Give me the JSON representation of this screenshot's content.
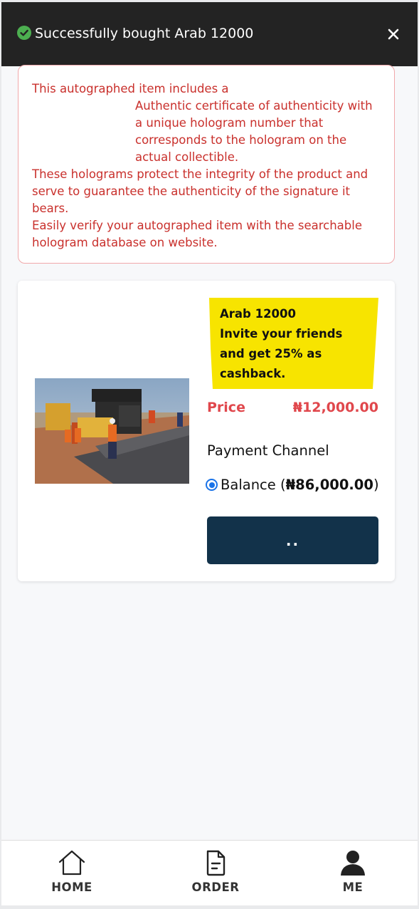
{
  "toast": {
    "message": "Successfully bought Arab 12000",
    "icons": {
      "status": "check-circle-icon",
      "close": "close-icon"
    },
    "colors": {
      "background": "#232323",
      "success": "#4caf50"
    }
  },
  "notice": {
    "line1": "This autographed item includes a",
    "line2": "Authentic certificate of authenticity with a unique hologram number that corresponds to the hologram on the actual collectible.",
    "line3": "These holograms protect the integrity of the product and serve to guarantee the authenticity of the signature it bears.",
    "line4": "Easily verify your autographed item with the searchable hologram database on website.",
    "color": "#c9302c"
  },
  "product": {
    "promo_name": "Arab 12000",
    "promo_text": "Invite your friends and get 25% as cashback.",
    "price_label": "Price",
    "price_value": "₦12,000.00",
    "payment_title": "Payment Channel",
    "payment_option_label": "Balance (",
    "payment_option_amount": "₦86,000.00",
    "payment_option_suffix": ")",
    "payment_selected": true,
    "buy_button_label": "..",
    "colors": {
      "tag": "#f7e400",
      "price": "#e0474c",
      "button": "#12324a"
    }
  },
  "tabbar": {
    "items": [
      {
        "label": "HOME",
        "icon": "home-icon"
      },
      {
        "label": "ORDER",
        "icon": "document-icon"
      },
      {
        "label": "ME",
        "icon": "user-icon"
      }
    ]
  }
}
